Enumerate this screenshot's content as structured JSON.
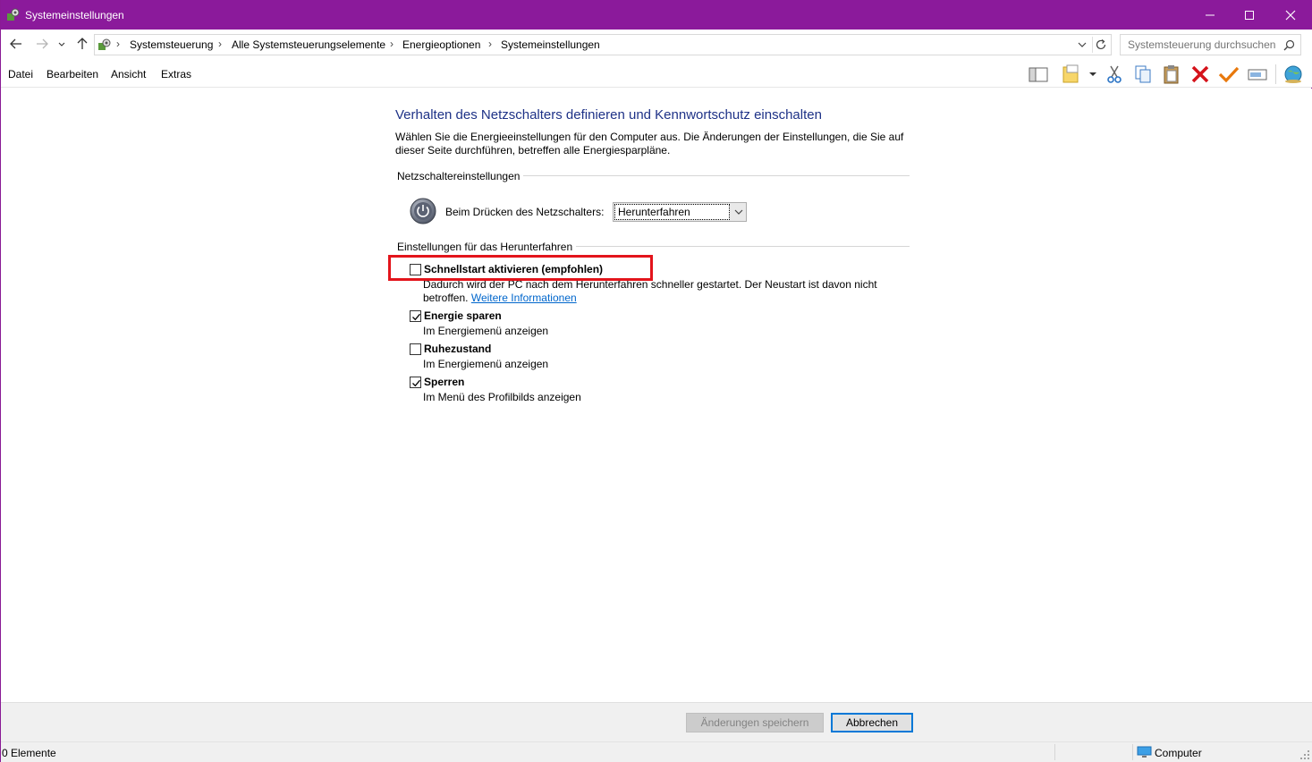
{
  "window": {
    "title": "Systemeinstellungen",
    "accent_color": "#8b1a9b"
  },
  "address": {
    "crumbs": [
      "Systemsteuerung",
      "Alle Systemsteuerungselemente",
      "Energieoptionen",
      "Systemeinstellungen"
    ],
    "search_placeholder": "Systemsteuerung durchsuchen"
  },
  "menu": {
    "items": [
      "Datei",
      "Bearbeiten",
      "Ansicht",
      "Extras"
    ]
  },
  "toolbar": {
    "icons": [
      "preview-pane-icon",
      "new-folder-icon",
      "cut-icon",
      "copy-icon",
      "paste-icon",
      "delete-icon",
      "checkmark-icon",
      "rename-icon",
      "globe-icon"
    ]
  },
  "main": {
    "heading": "Verhalten des Netzschalters definieren und Kennwortschutz einschalten",
    "intro": "Wählen Sie die Energieeinstellungen für den Computer aus. Die Änderungen der Einstellungen, die Sie auf dieser Seite durchführen, betreffen alle Energiesparpläne.",
    "power_group_label": "Netzschaltereinstellungen",
    "power_button_label": "Beim Drücken des Netzschalters:",
    "power_button_value": "Herunterfahren",
    "shutdown_group_label": "Einstellungen für das Herunterfahren",
    "options": [
      {
        "label": "Schnellstart aktivieren (empfohlen)",
        "checked": false,
        "desc": "Dadurch wird der PC nach dem Herunterfahren schneller gestartet. Der Neustart ist davon nicht betroffen.",
        "link": "Weitere Informationen"
      },
      {
        "label": "Energie sparen",
        "checked": true,
        "desc": "Im Energiemenü anzeigen"
      },
      {
        "label": "Ruhezustand",
        "checked": false,
        "desc": "Im Energiemenü anzeigen"
      },
      {
        "label": "Sperren",
        "checked": true,
        "desc": "Im Menü des Profilbilds anzeigen"
      }
    ],
    "highlight_color": "#e3141b"
  },
  "buttons": {
    "save": "Änderungen speichern",
    "cancel": "Abbrechen"
  },
  "status": {
    "items": "0 Elemente",
    "zone": "Computer"
  }
}
